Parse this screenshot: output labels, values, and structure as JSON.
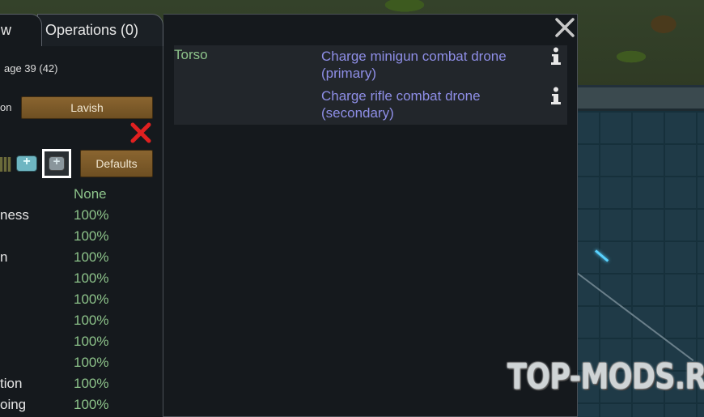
{
  "tabs": [
    {
      "label": "w"
    },
    {
      "label": "Operations (0)"
    }
  ],
  "left_panel": {
    "age_text": "age 39 (42)",
    "food_label": "on",
    "food_restriction": "Lavish",
    "defaults_label": "Defaults",
    "capacities_header": "None",
    "capacities": [
      {
        "label": "ness",
        "value": "100%"
      },
      {
        "label": "",
        "value": "100%"
      },
      {
        "label": "n",
        "value": "100%"
      },
      {
        "label": "",
        "value": "100%"
      },
      {
        "label": "",
        "value": "100%"
      },
      {
        "label": "",
        "value": "100%"
      },
      {
        "label": "",
        "value": "100%"
      },
      {
        "label": "",
        "value": "100%"
      },
      {
        "label": "tion",
        "value": "100%"
      },
      {
        "label": "oing",
        "value": "100%"
      }
    ]
  },
  "dialog": {
    "parts": [
      {
        "name": "Torso",
        "hediffs": [
          {
            "text": "Charge minigun combat drone (primary)"
          },
          {
            "text": "Charge rifle combat drone (secondary)"
          }
        ]
      }
    ]
  },
  "icons": {
    "close": "close-icon",
    "info": "info-icon",
    "clear": "red-x-icon"
  },
  "colors": {
    "part_text": "#8dc38a",
    "hediff_text": "#8e8ee6",
    "panel_bg": "#15191d"
  },
  "watermark": "TOP-MODS.RU"
}
